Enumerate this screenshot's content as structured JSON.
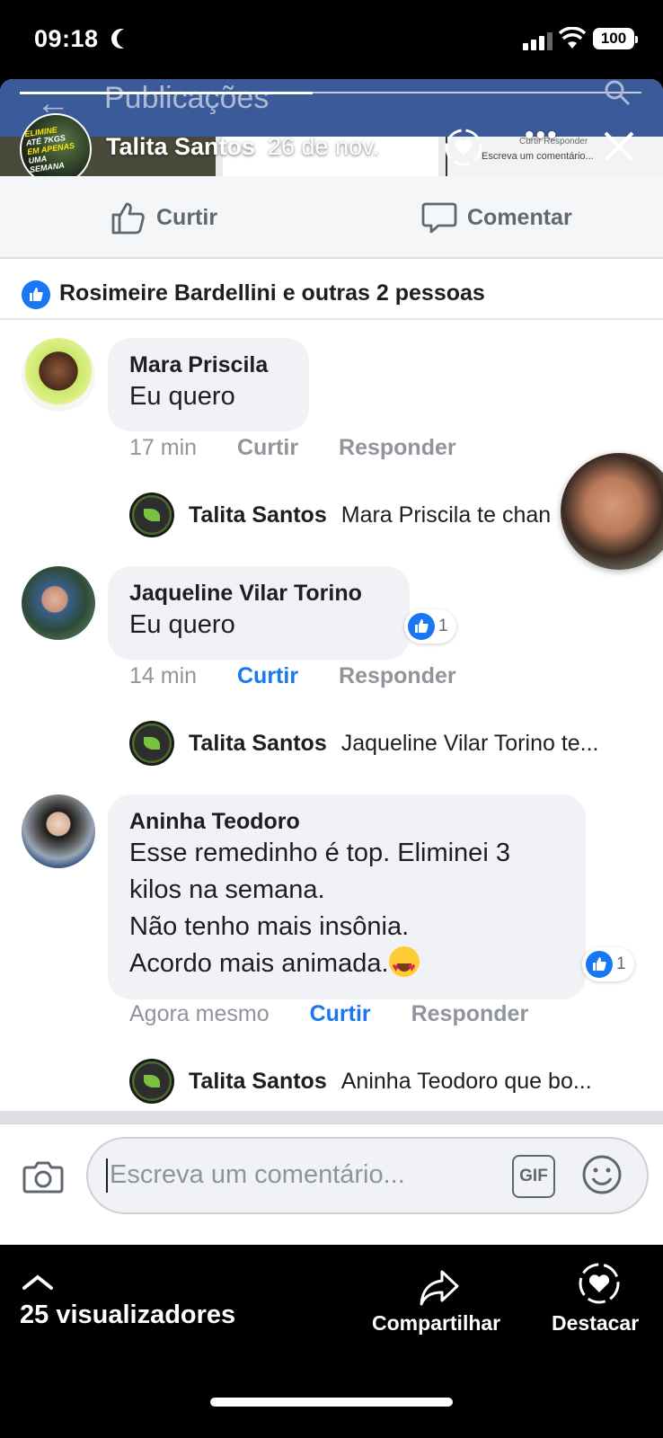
{
  "status_bar": {
    "time": "09:18",
    "battery": "100"
  },
  "fb_header": {
    "title": "Publicações",
    "thumb_text": "Escreva um comentário...",
    "thumb_top": "Curtir   Responder"
  },
  "story": {
    "author": "Talita Santos",
    "date": "26 de nov.",
    "avatar_text": {
      "line1": "ELIMINE",
      "line2": "ATÉ 7KGS",
      "line3": "EM APENAS",
      "line4": "UMA SEMANA"
    }
  },
  "actions": {
    "like": "Curtir",
    "comment": "Comentar"
  },
  "reactions": {
    "text": "Rosimeire Bardellini e outras 2 pessoas"
  },
  "comments": [
    {
      "name": "Mara Priscila",
      "lines": [
        "Eu quero"
      ],
      "time": "17 min",
      "like": "Curtir",
      "reply": "Responder",
      "reply_preview": {
        "name": "Talita Santos",
        "text": "Mara Priscila te chan"
      }
    },
    {
      "name": "Jaqueline Vilar Torino",
      "lines": [
        "Eu quero"
      ],
      "likes": "1",
      "time": "14 min",
      "like": "Curtir",
      "reply": "Responder",
      "reply_preview": {
        "name": "Talita Santos",
        "text": "Jaqueline Vilar Torino te..."
      }
    },
    {
      "name": "Aninha Teodoro",
      "lines": [
        "Esse remedinho é top. Eliminei 3",
        "kilos na semana.",
        "Não tenho mais insônia.",
        "Acordo mais animada."
      ],
      "likes": "1",
      "time": "Agora mesmo",
      "like": "Curtir",
      "reply": "Responder",
      "reply_preview": {
        "name": "Talita Santos",
        "text": "Aninha Teodoro  que bo..."
      }
    }
  ],
  "composer": {
    "placeholder": "Escreva um comentário...",
    "gif": "GIF"
  },
  "story_bar": {
    "viewers": "25 visualizadores",
    "share": "Compartilhar",
    "highlight": "Destacar"
  },
  "colors": {
    "fb_blue": "#3b5a99",
    "like_blue": "#1877f2",
    "bubble": "#f0f2f5",
    "meta_gray": "#90949c"
  }
}
